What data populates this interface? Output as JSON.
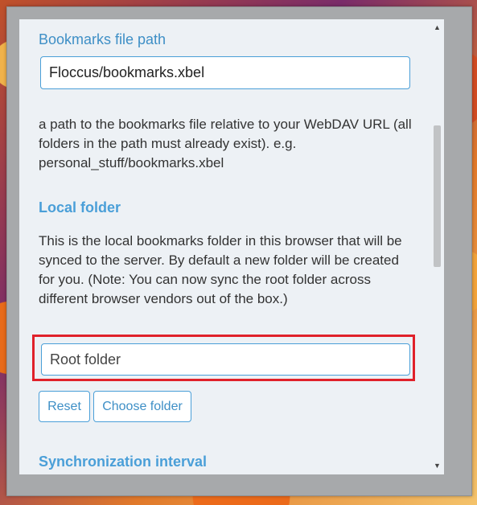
{
  "file_path": {
    "title": "Bookmarks file path",
    "value": "Floccus/bookmarks.xbel",
    "description": "a path to the bookmarks file relative to your WebDAV URL (all folders in the path must already exist). e.g. personal_stuff/bookmarks.xbel"
  },
  "local_folder": {
    "heading": "Local folder",
    "description": "This is the local bookmarks folder in this browser that will be synced to the server. By default a new folder will be created for you. (Note: You can now sync the root folder across different browser vendors out of the box.)",
    "value": "Root folder",
    "reset_label": "Reset",
    "choose_label": "Choose folder"
  },
  "sync_interval": {
    "heading": "Synchronization interval"
  },
  "scrollbar": {
    "up_icon": "scroll-up-arrow-icon",
    "down_icon": "scroll-down-arrow-icon"
  },
  "colors": {
    "accent": "#4a9fd8",
    "highlight": "#e0212a",
    "panel_background": "#edf1f5"
  }
}
